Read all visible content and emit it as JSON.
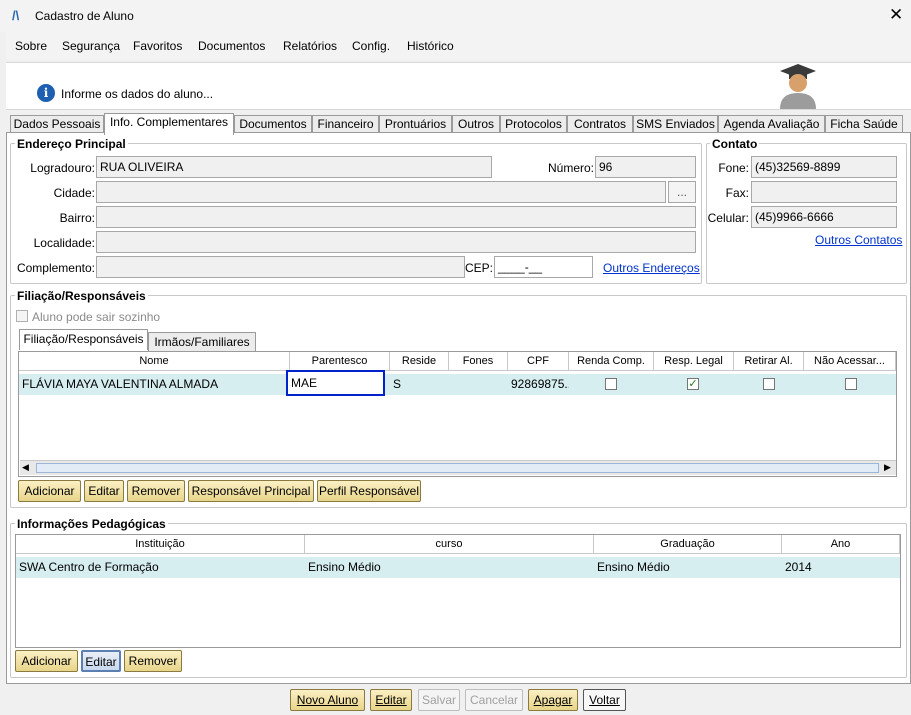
{
  "window": {
    "title": "Cadastro de Aluno"
  },
  "menu": [
    "Sobre",
    "Segurança",
    "Favoritos",
    "Documentos",
    "Relatórios",
    "Config.",
    "Histórico"
  ],
  "header": {
    "info_text": "Informe os dados do aluno..."
  },
  "tabs": [
    "Dados Pessoais",
    "Info. Complementares",
    "Documentos",
    "Financeiro",
    "Prontuários",
    "Outros",
    "Protocolos",
    "Contratos",
    "SMS Enviados",
    "Agenda Avaliação",
    "Ficha Saúde"
  ],
  "endereco": {
    "title": "Endereço Principal",
    "logradouro_label": "Logradouro:",
    "logradouro": "RUA OLIVEIRA",
    "numero_label": "Número:",
    "numero": "96",
    "cidade_label": "Cidade:",
    "cidade": "",
    "browse": "...",
    "bairro_label": "Bairro:",
    "bairro": "",
    "localidade_label": "Localidade:",
    "localidade": "",
    "complemento_label": "Complemento:",
    "complemento": "",
    "cep_label": "CEP:",
    "cep": "____-__",
    "outros_link": "Outros Endereços"
  },
  "contato": {
    "title": "Contato",
    "fone_label": "Fone:",
    "fone": "(45)32569-8899",
    "fax_label": "Fax:",
    "fax": "",
    "celular_label": "Celular:",
    "celular": "(45)9966-6666",
    "outros_link": "Outros Contatos"
  },
  "filiacao": {
    "title": "Filiação/Responsáveis",
    "sozinho_label": "Aluno pode sair sozinho",
    "subtabs": [
      "Filiação/Responsáveis",
      "Irmãos/Familiares"
    ],
    "columns": [
      "Nome",
      "Parentesco",
      "Reside",
      "Fones",
      "CPF",
      "Renda Comp.",
      "Resp. Legal",
      "Retirar Al.",
      "Não Acessar..."
    ],
    "rows": [
      {
        "nome": "FLÁVIA MAYA VALENTINA ALMADA",
        "parentesco": "MAE",
        "reside": "S",
        "fones": "",
        "cpf": "92869875...",
        "renda": false,
        "resp_legal": true,
        "retirar": false,
        "nao_acessar": false
      }
    ],
    "buttons": [
      "Adicionar",
      "Editar",
      "Remover",
      "Responsável Principal",
      "Perfil Responsável"
    ]
  },
  "pedagogicas": {
    "title": "Informações Pedagógicas",
    "columns": [
      "Instituição",
      "curso",
      "Graduação",
      "Ano"
    ],
    "rows": [
      {
        "instituicao": "SWA Centro de Formação",
        "curso": "Ensino Médio",
        "graduacao": "Ensino Médio",
        "ano": "2014"
      }
    ],
    "buttons": [
      "Adicionar",
      "Editar",
      "Remover"
    ]
  },
  "footer": {
    "buttons": [
      "Novo Aluno",
      "Editar",
      "Salvar",
      "Cancelar",
      "Apagar",
      "Voltar"
    ]
  },
  "colors": {
    "accent_highlight": "#0022cc",
    "row_selected": "#d7eef0",
    "button": "#f2e3a6"
  }
}
